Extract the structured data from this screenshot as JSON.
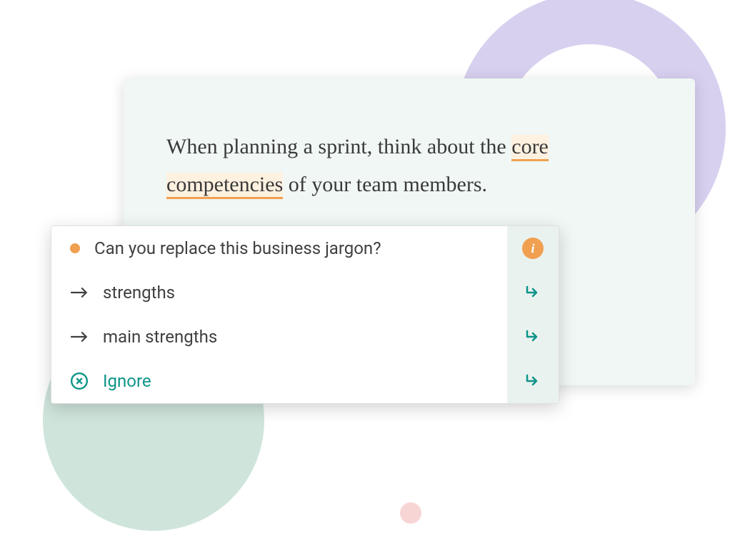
{
  "editor": {
    "text_before": "When planning a sprint, think about the ",
    "highlighted": "core competencies",
    "text_after": " of your team members."
  },
  "suggestion": {
    "prompt": "Can you replace this business jargon?",
    "info_glyph": "i",
    "options": [
      {
        "label": "strengths"
      },
      {
        "label": "main strengths"
      }
    ],
    "ignore_label": "Ignore"
  },
  "colors": {
    "accent_orange": "#f0a050",
    "accent_teal": "#0d9488",
    "bg_mint": "#f0f7f4",
    "circle_purple": "#d8d0ef",
    "circle_green": "#cfe5db",
    "circle_pink": "#f8d5d5"
  }
}
